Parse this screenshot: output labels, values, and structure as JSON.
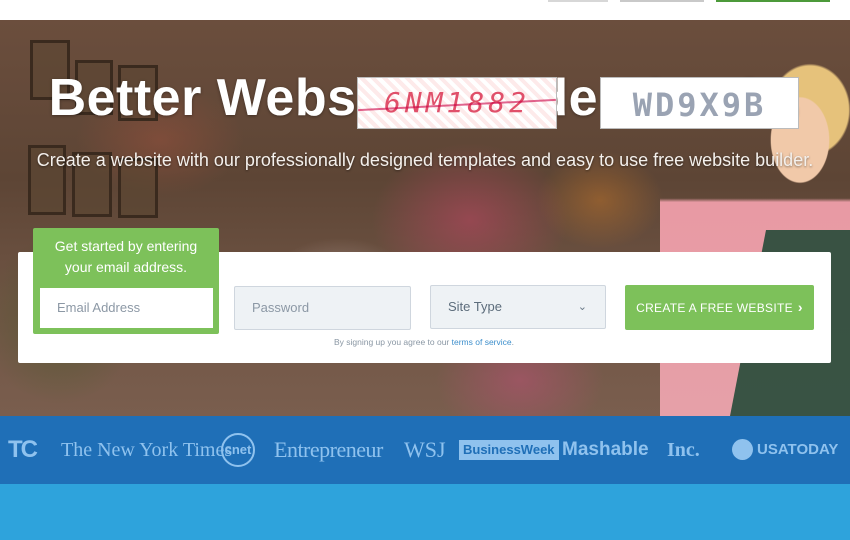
{
  "hero": {
    "title": "Better Websites Made Simple.",
    "subtitle": "Create a website with our professionally designed templates and easy to use free website builder."
  },
  "captcha": {
    "first": "6NM1882",
    "second": "WD9X9B"
  },
  "signup": {
    "tip": "Get started by entering your email address.",
    "email_placeholder": "Email Address",
    "password_placeholder": "Password",
    "site_type_value": "Site Type",
    "cta_label": "CREATE A FREE WEBSITE",
    "cta_arrow": "›",
    "terms_prefix": "By signing up you agree to our ",
    "terms_link": "terms of service",
    "terms_suffix": "."
  },
  "press": {
    "logos": [
      "TC",
      "The New York Times",
      "cnet",
      "Entrepreneur",
      "WSJ",
      "BusinessWeek",
      "Mashable",
      "Inc.",
      "USATODAY"
    ]
  },
  "colors": {
    "accent_green": "#7dc15a",
    "press_blue": "#1f6fb7",
    "bottom_blue": "#2ea3dc"
  }
}
